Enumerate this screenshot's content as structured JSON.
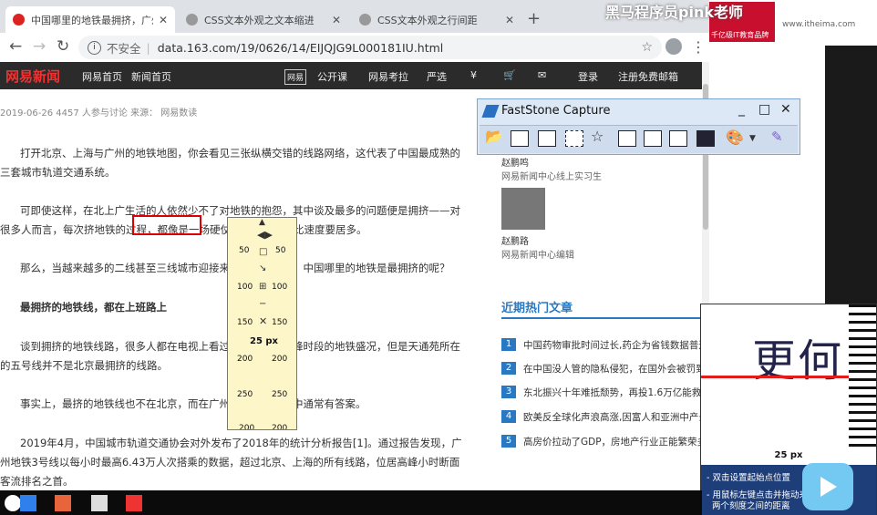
{
  "browser": {
    "tabs": [
      {
        "title": "中国哪里的地铁最拥挤，广州3号",
        "active": true
      },
      {
        "title": "CSS文本外观之文本缩进",
        "active": false
      },
      {
        "title": "CSS文本外观之行间距",
        "active": false
      }
    ],
    "new_tab": "+",
    "security_label": "不安全",
    "url": "data.163.com/19/0626/14/EIJQJG9L000181IU.html"
  },
  "site_nav": {
    "logo": "网易新闻",
    "items": [
      "网易首页",
      "新闻首页",
      "网易",
      "公开课",
      "网易考拉",
      "严选",
      "¥",
      "",
      "",
      "登录",
      "注册免费邮箱"
    ]
  },
  "article": {
    "meta": "2019-06-26   4457 人参与讨论   来源：  网易数读",
    "paragraphs": [
      "打开北京、上海与广州的地铁地图，你会看见三张纵横交错的线路网络，这代表了中国最成熟的三套城市轨道交通系统。",
      "可即使这样，在北上广生活的人依然少不了对地铁的抱怨，其中谈及最多的问题便是拥挤——对很多人而言，每次挤地铁的过程，都像是一场硬仗，更何况还要比速度要居多。",
      "那么，当越来越多的二线甚至三线城市迎接来了地铁的时代，中国哪里的地铁是最拥挤的呢？",
      "最拥挤的地铁线，都在上班路上",
      "谈到拥挤的地铁线路，很多人都在电视上看过北京地铁早高峰时段的地铁盛况，但是天通苑所在的五号线并不是北京最拥挤的线路。",
      "事实上，最挤的地铁线也不在北京，而在广州——广州人心中通常有答案。",
      "2019年4月，中国城市轨道交通协会对外发布了2018年的统计分析报告[1]。通过报告发现，广州地铁3号线以每小时最高6.43万人次搭乘的数据，超过北京、上海的所有线路，位居高峰小时断面客流排名之首。"
    ],
    "bold_indexes": [
      3
    ]
  },
  "sidebar": {
    "authors": [
      {
        "name": "赵鹏鸣",
        "desc": "网易新闻中心线上实习生"
      },
      {
        "name": "赵鹏路",
        "desc": "网易新闻中心编辑"
      }
    ],
    "hot_title": "近期热门文章",
    "hot_items": [
      {
        "num": "1",
        "text": "中国药物审批时间过长,药企为省钱数据普遍造假"
      },
      {
        "num": "2",
        "text": "在中国没人管的隐私侵犯，在国外会被罚到破产"
      },
      {
        "num": "3",
        "text": "东北振兴十年难抵颓势，再投1.6万亿能救经济吗"
      },
      {
        "num": "4",
        "text": "欧美反全球化声浪高涨,因富人和亚洲中产最受益"
      },
      {
        "num": "5",
        "text": "高房价拉动了GDP，房地产行业正能繁荣多久"
      }
    ]
  },
  "faststone": {
    "title": "FastStone Capture",
    "controls": [
      "_",
      "□",
      "✕"
    ]
  },
  "ruler": {
    "ticks": [
      "50",
      "100",
      "150",
      "200",
      "250",
      "200"
    ],
    "measure": "25 px"
  },
  "magnifier": {
    "text": "更何",
    "measure": "25 px",
    "tips": [
      "- 双击设置起始点位置",
      "- 用鼠标左键点击并拖动来获取",
      "两个刻度之间的距离"
    ]
  },
  "overlay": {
    "channel_title": "黑马程序员pink老师",
    "brand": "www.itheima.com",
    "logo_line": "千亿级IT教育品牌"
  },
  "colors": {
    "accent": "#2a78c2",
    "nav_bg": "#2b2b2b",
    "highlight": "#dd0000"
  }
}
